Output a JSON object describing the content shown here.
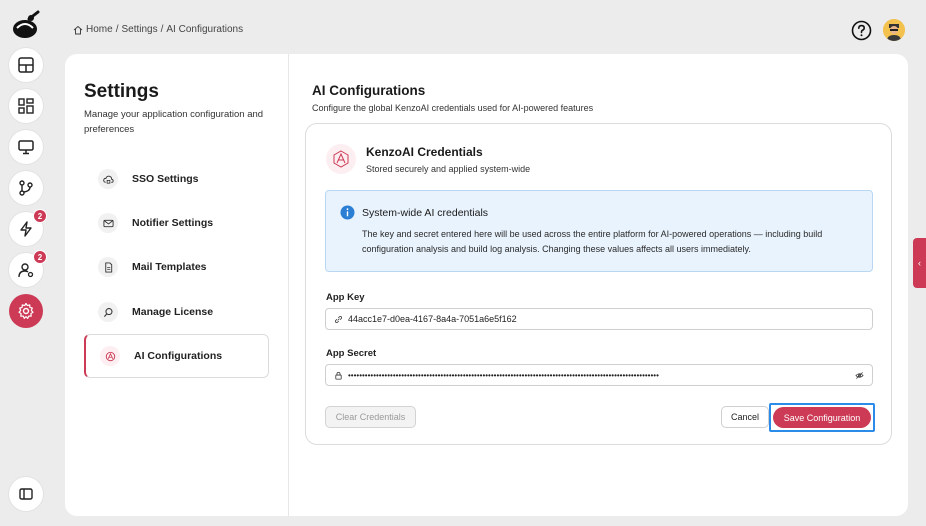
{
  "breadcrumb": {
    "home": "Home",
    "settings": "Settings",
    "current": "AI Configurations",
    "separator": "/"
  },
  "rail": {
    "badges": {
      "actions": "2",
      "users": "2"
    }
  },
  "settings": {
    "title": "Settings",
    "description": "Manage your application configuration and preferences",
    "items": [
      {
        "label": "SSO Settings",
        "icon": "cloud-lock-icon"
      },
      {
        "label": "Notifier Settings",
        "icon": "mail-icon"
      },
      {
        "label": "Mail Templates",
        "icon": "document-icon"
      },
      {
        "label": "Manage License",
        "icon": "search-icon"
      },
      {
        "label": "AI Configurations",
        "icon": "ai-logo-icon",
        "active": true
      }
    ]
  },
  "content": {
    "title": "AI Configurations",
    "description": "Configure the global KenzoAI credentials used for AI-powered features",
    "card": {
      "title": "KenzoAI Credentials",
      "subtitle": "Stored securely and applied system-wide",
      "info": {
        "title": "System-wide AI credentials",
        "text": "The key and secret entered here will be used across the entire platform for AI-powered operations — including build configuration analysis and build log analysis. Changing these values affects all users immediately."
      },
      "app_key": {
        "label": "App Key",
        "value": "44acc1e7-d0ea-4167-8a4a-7051a6e5f162"
      },
      "app_secret": {
        "label": "App Secret",
        "value": "•••••••••••••••••••••••••••••••••••••••••••••••••••••••••••••••••••••••••••••••••••••••••••••••••••••••••••••••"
      },
      "buttons": {
        "clear": "Clear Credentials",
        "cancel": "Cancel",
        "save": "Save Configuration"
      }
    }
  },
  "colors": {
    "accent": "#cc3a55",
    "info_bg": "#e9f3fd",
    "focus": "#2a8ce8"
  }
}
